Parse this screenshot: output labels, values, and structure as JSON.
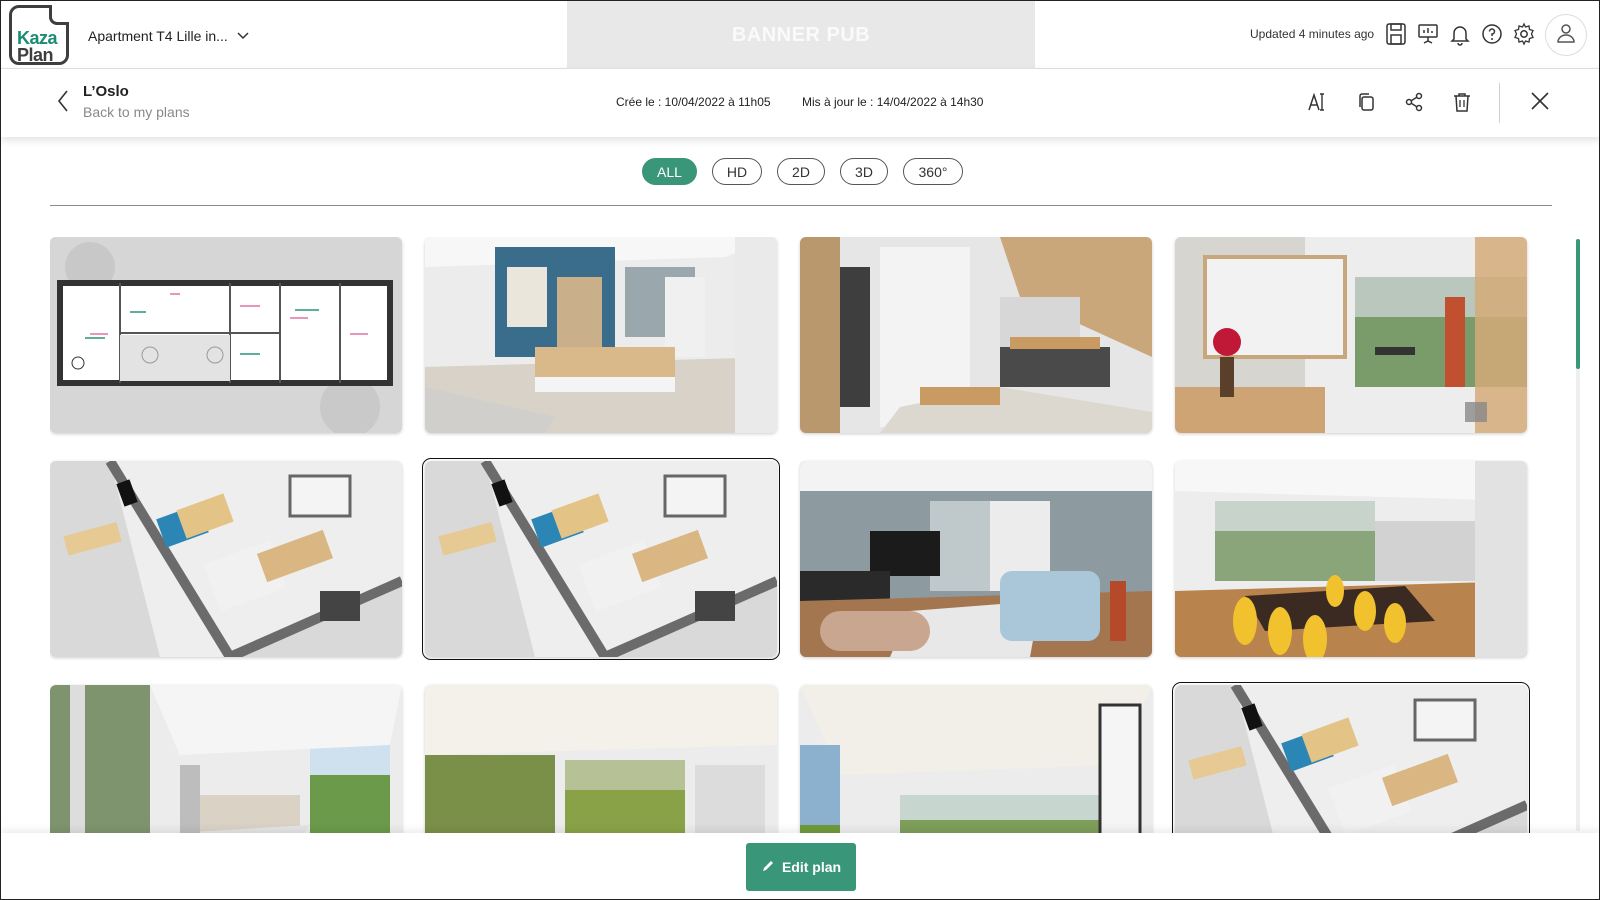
{
  "header": {
    "logo": "Kaza Plan",
    "project_name": "Apartment T4 Lille in...",
    "banner": "BANNER PUB",
    "updated": "Updated 4 minutes ago",
    "icons": [
      "save-icon",
      "presentation-icon",
      "bell-icon",
      "help-icon",
      "gear-icon",
      "user-icon"
    ]
  },
  "plan": {
    "title": "L’Oslo",
    "back_label": "Back to my plans",
    "created": "Crée le : 10/04/2022 à 11h05",
    "updated": "Mis à jour le : 14/04/2022 à 14h30",
    "actions": [
      "rename-icon",
      "duplicate-icon",
      "share-icon",
      "delete-icon",
      "close-icon"
    ]
  },
  "filters": [
    {
      "label": "ALL",
      "active": true
    },
    {
      "label": "HD",
      "active": false
    },
    {
      "label": "2D",
      "active": false
    },
    {
      "label": "3D",
      "active": false
    },
    {
      "label": "360°",
      "active": false
    }
  ],
  "gallery": [
    {
      "kind": "floorplan",
      "selected": false
    },
    {
      "kind": "kitchen",
      "selected": false
    },
    {
      "kind": "bathroom",
      "selected": false
    },
    {
      "kind": "office",
      "selected": false
    },
    {
      "kind": "aerial",
      "selected": false
    },
    {
      "kind": "aerial",
      "selected": true
    },
    {
      "kind": "living-room",
      "selected": false
    },
    {
      "kind": "dining",
      "selected": false
    },
    {
      "kind": "open-kitchen",
      "selected": false
    },
    {
      "kind": "open-living",
      "selected": false
    },
    {
      "kind": "wide-living",
      "selected": false
    },
    {
      "kind": "aerial",
      "selected": true
    }
  ],
  "footer": {
    "edit_label": "Edit plan"
  },
  "colors": {
    "accent": "#3a9678"
  }
}
